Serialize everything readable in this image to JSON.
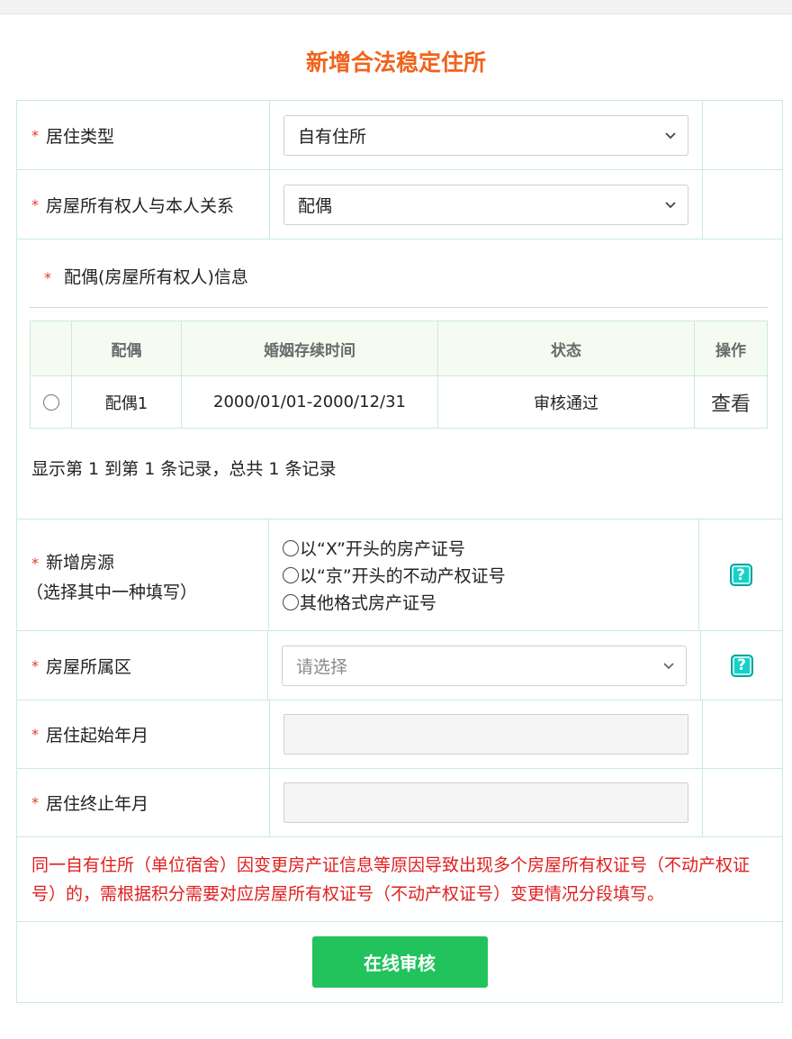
{
  "page_title": "新增合法稳定住所",
  "required_mark": "*",
  "fields": {
    "residence_type": {
      "label": "居住类型",
      "value": "自有住所"
    },
    "owner_relation": {
      "label": "房屋所有权人与本人关系",
      "value": "配偶"
    },
    "spouse_info": {
      "label": "配偶(房屋所有权人)信息",
      "columns": [
        "",
        "配偶",
        "婚姻存续时间",
        "状态",
        "操作"
      ],
      "rows": [
        {
          "spouse": "配偶1",
          "period": "2000/01/01-2000/12/31",
          "status": "审核通过",
          "action": "查看"
        }
      ],
      "records_text": "显示第 1 到第 1 条记录，总共 1 条记录"
    },
    "new_house_source": {
      "label_line1": "新增房源",
      "label_line2": "（选择其中一种填写）",
      "options": [
        "以“X”开头的房产证号",
        "以“京”开头的不动产权证号",
        "其他格式房产证号"
      ]
    },
    "district": {
      "label": "房屋所属区",
      "placeholder": "请选择"
    },
    "start_month": {
      "label": "居住起始年月",
      "value": ""
    },
    "end_month": {
      "label": "居住终止年月",
      "value": ""
    }
  },
  "notice": "同一自有住所（单位宿舍）因变更房产证信息等原因导致出现多个房屋所有权证号（不动产权证号）的，需根据积分需要对应房屋所有权证号（不动产权证号）变更情况分段填写。",
  "submit_label": "在线审核",
  "help_glyph": "?",
  "colors": {
    "title": "#f0641e",
    "required": "#e5372b",
    "notice": "#e01f1f",
    "submit_bg": "#22c25c",
    "border": "#c9ebd6",
    "help_icon": "#15d1c9"
  }
}
